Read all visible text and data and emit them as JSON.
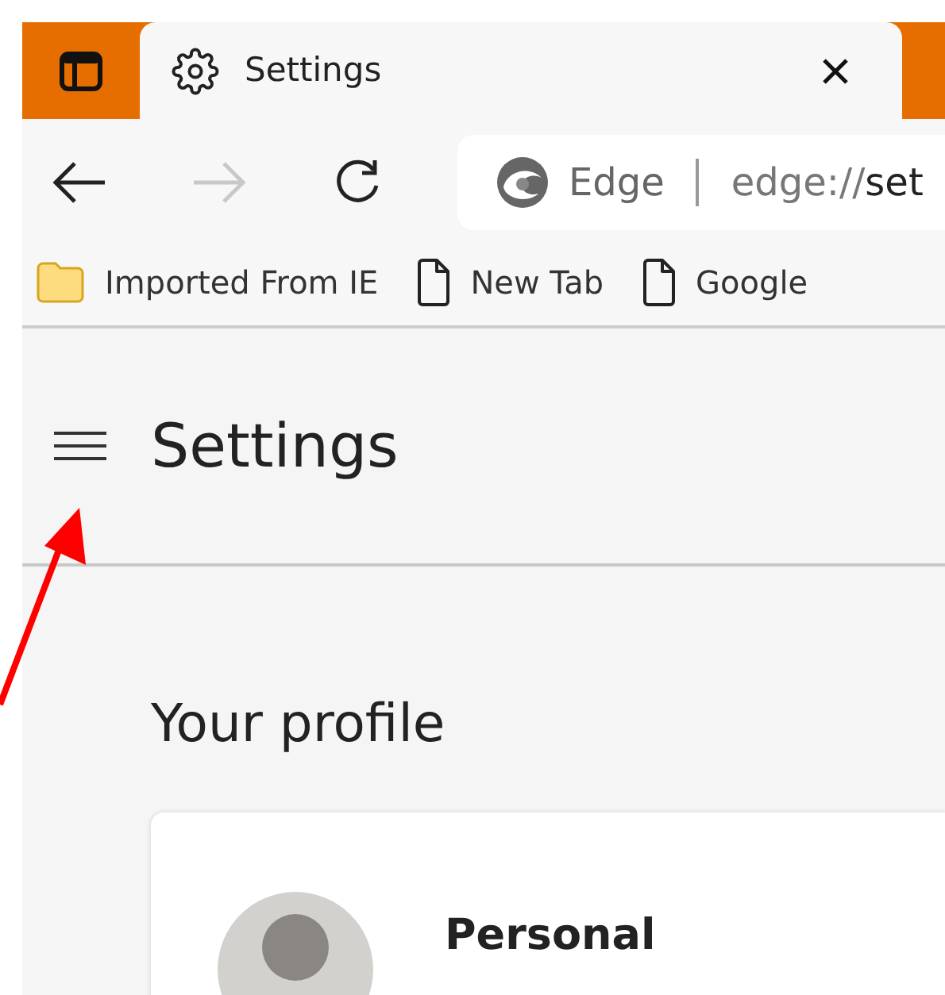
{
  "tab": {
    "title": "Settings",
    "selected": true
  },
  "address_bar": {
    "site_label": "Edge",
    "url_prefix": "edge://",
    "url_rest": "set"
  },
  "nav": {
    "back_disabled": false,
    "forward_disabled": true
  },
  "favorites": [
    {
      "kind": "folder",
      "label": "Imported From IE"
    },
    {
      "kind": "page",
      "label": "New Tab"
    },
    {
      "kind": "page",
      "label": "Google"
    }
  ],
  "page": {
    "title": "Settings",
    "section_title": "Your profile",
    "profile_name": "Personal"
  }
}
